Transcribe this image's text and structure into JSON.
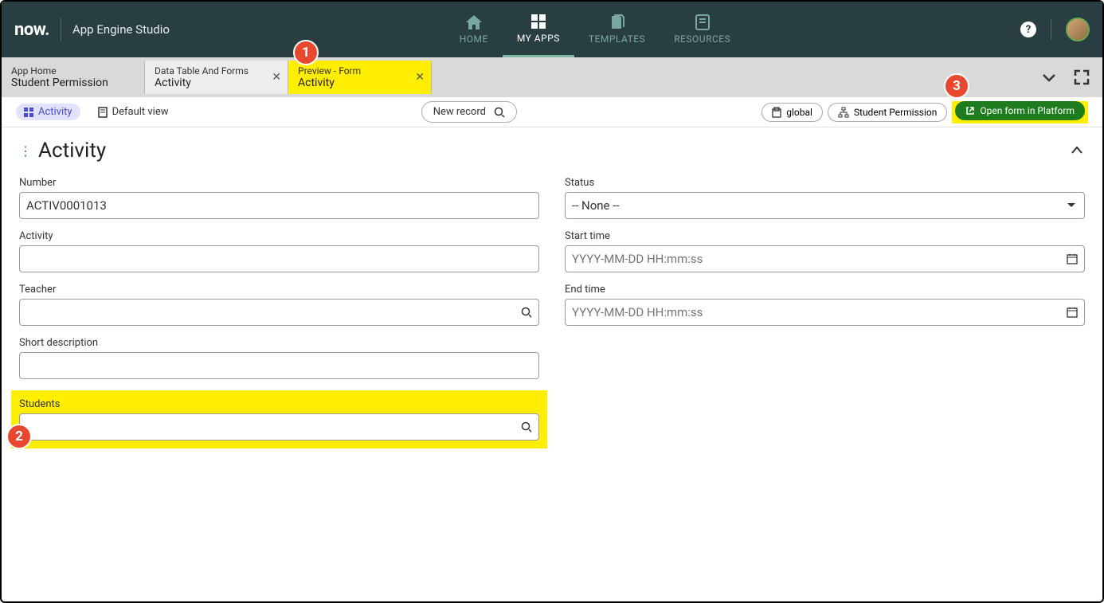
{
  "header": {
    "logo": "now.",
    "app_title": "App Engine Studio",
    "nav": [
      {
        "label": "HOME",
        "icon": "home-icon"
      },
      {
        "label": "MY APPS",
        "icon": "apps-icon",
        "active": true
      },
      {
        "label": "TEMPLATES",
        "icon": "templates-icon"
      },
      {
        "label": "RESOURCES",
        "icon": "resources-icon"
      }
    ]
  },
  "tabs": [
    {
      "line1": "App Home",
      "line2": "Student Permission",
      "kind": "home"
    },
    {
      "line1": "Data Table And Forms",
      "line2": "Activity",
      "kind": "dt",
      "closable": true
    },
    {
      "line1": "Preview - Form",
      "line2": "Activity",
      "kind": "preview",
      "closable": true
    }
  ],
  "toolbar": {
    "activity_chip": "Activity",
    "default_view": "Default view",
    "new_record": "New record",
    "global": "global",
    "student_permission": "Student Permission",
    "open_platform": "Open form in Platform"
  },
  "form": {
    "title": "Activity",
    "fields": {
      "number": {
        "label": "Number",
        "value": "ACTIV0001013"
      },
      "status": {
        "label": "Status",
        "value": "-- None --"
      },
      "activity": {
        "label": "Activity",
        "value": ""
      },
      "start_time": {
        "label": "Start time",
        "placeholder": "YYYY-MM-DD HH:mm:ss"
      },
      "teacher": {
        "label": "Teacher",
        "value": ""
      },
      "end_time": {
        "label": "End time",
        "placeholder": "YYYY-MM-DD HH:mm:ss"
      },
      "short_description": {
        "label": "Short description",
        "value": ""
      },
      "students": {
        "label": "Students",
        "value": ""
      }
    }
  },
  "annotations": {
    "b1": "1",
    "b2": "2",
    "b3": "3"
  }
}
